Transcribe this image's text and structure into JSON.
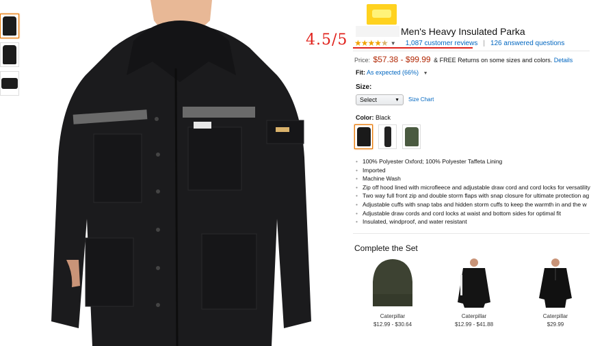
{
  "thumbnails": [
    {
      "name": "front-view"
    },
    {
      "name": "hooded-view"
    },
    {
      "name": "folded-view"
    }
  ],
  "product": {
    "title": "Men's Heavy Insulated Parka",
    "rating_annotation": "4.5/5",
    "reviews_link": "1,087 customer reviews",
    "questions_link": "126 answered questions",
    "price_label": "Price:",
    "price_range": "$57.38 - $99.99",
    "price_note": "& FREE Returns on some sizes and colors.",
    "price_details_link": "Details",
    "fit_label": "Fit:",
    "fit_value": "As expected (66%)",
    "size_label": "Size:",
    "size_select": "Select",
    "size_chart_link": "Size Chart",
    "color_label": "Color:",
    "color_value": "Black",
    "swatch_colors": [
      "#1a1a1a",
      "#2a2a2a",
      "#4a5a40"
    ],
    "features": [
      "100% Polyester Oxford; 100% Polyester Taffeta Lining",
      "Imported",
      "Machine Wash",
      "Zip off hood lined with microfleece and adjustable draw cord and cord locks for versatility",
      "Two way full front zip and double storm flaps with snap closure for ultimate protection ag",
      "Adjustable cuffs with snap tabs and hidden storm cuffs to keep the warmth in and the w",
      "Adjustable draw cords and cord locks at waist and bottom sides for optimal fit",
      "Insulated, windproof, and water resistant"
    ]
  },
  "complete_set": {
    "title": "Complete the Set",
    "items": [
      {
        "brand": "Caterpillar",
        "price": "$12.99 - $30.64"
      },
      {
        "brand": "Caterpillar",
        "price": "$12.99 - $41.88"
      },
      {
        "brand": "Caterpillar",
        "price": "$29.99"
      }
    ]
  },
  "colors": {
    "link": "#0066c0",
    "price": "#b12704",
    "star": "#f0a200",
    "annotation": "#e0201a",
    "selected_border": "#e77600"
  }
}
